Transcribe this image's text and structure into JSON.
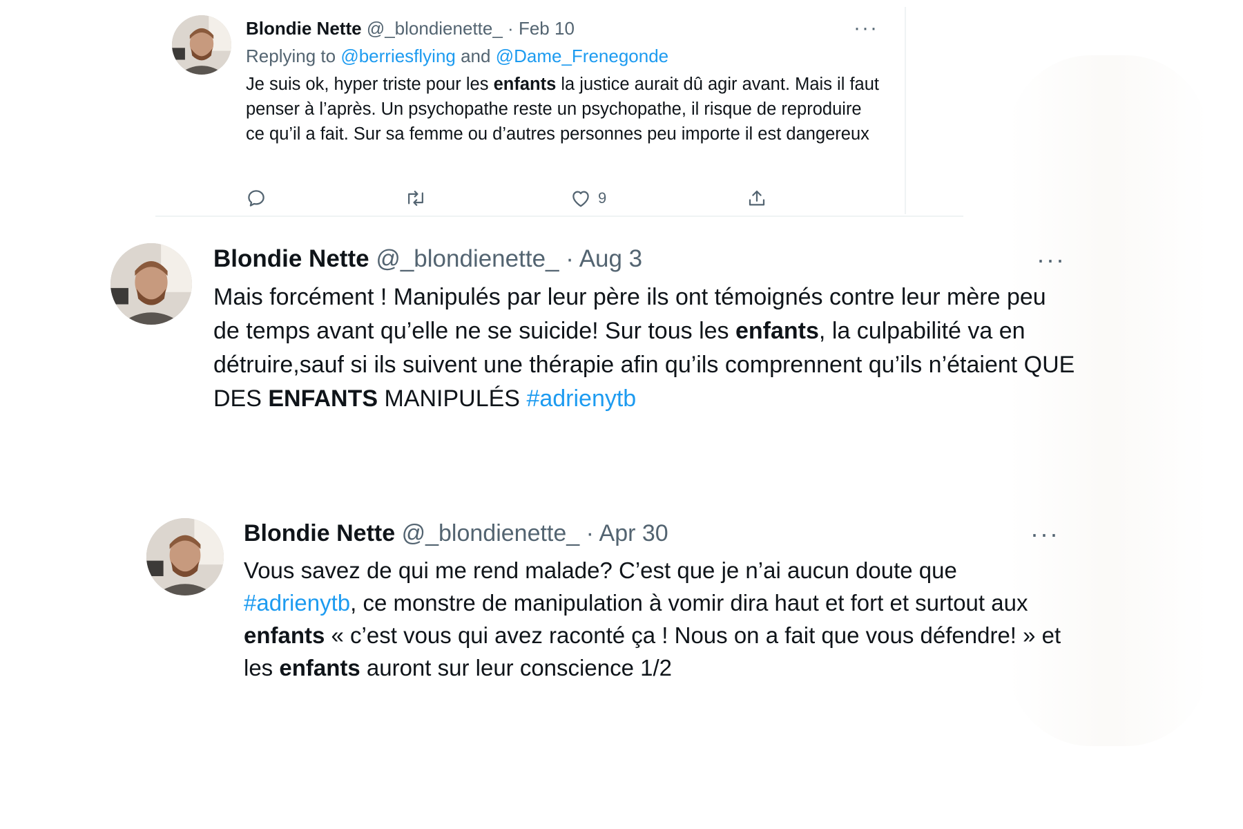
{
  "tweets": [
    {
      "author": {
        "name": "Blondie Nette",
        "handle": "@_blondienette_",
        "separator": "·",
        "date": "Feb 10",
        "avatar": "profile-photo"
      },
      "more_label": "···",
      "reply_prefix": "Replying to ",
      "reply_mention_1": "@berriesflying",
      "reply_and": " and ",
      "reply_mention_2": "@Dame_Frenegonde",
      "body": [
        {
          "text": "Je suis ok, hyper triste pour les "
        },
        {
          "text": "enfants",
          "bold": true
        },
        {
          "text": " la justice aurait dû agir avant. Mais il faut penser à l’après. Un psychopathe reste un psychopathe, il risque de reproduire ce qu’il a fait. Sur sa femme ou d’autres personnes peu importe il est dangereux"
        }
      ],
      "actions": {
        "reply_icon": "reply-icon",
        "retweet_icon": "retweet-icon",
        "like_icon": "heart-icon",
        "like_count": "9",
        "share_icon": "share-icon"
      }
    },
    {
      "author": {
        "name": "Blondie Nette",
        "handle": "@_blondienette_",
        "separator": "·",
        "date": "Aug 3",
        "avatar": "profile-photo"
      },
      "more_label": "···",
      "body": [
        {
          "text": "Mais forcément ! Manipulés par leur père ils ont témoignés contre leur mère peu de temps avant qu’elle ne se suicide! Sur tous les "
        },
        {
          "text": "enfants",
          "bold": true
        },
        {
          "text": ", la culpabilité va en détruire,sauf si ils suivent une thérapie afin qu’ils comprennent qu’ils n’étaient QUE DES "
        },
        {
          "text": "ENFANTS",
          "bold": true
        },
        {
          "text": " MANIPULÉS "
        },
        {
          "text": "#adrienytb",
          "hashtag": true
        }
      ]
    },
    {
      "author": {
        "name": "Blondie Nette",
        "handle": "@_blondienette_",
        "separator": "·",
        "date": "Apr 30",
        "avatar": "profile-photo"
      },
      "more_label": "···",
      "body": [
        {
          "text": "Vous savez de qui me rend malade? C’est que je n’ai aucun doute que "
        },
        {
          "text": "#adrienytb",
          "hashtag": true
        },
        {
          "text": ", ce monstre de manipulation à vomir dira haut et fort et surtout aux "
        },
        {
          "text": "enfants",
          "bold": true
        },
        {
          "text": " « c’est vous qui avez raconté ça ! Nous on a fait que vous défendre! » et les "
        },
        {
          "text": "enfants",
          "bold": true
        },
        {
          "text": " auront sur leur conscience 1/2"
        }
      ]
    }
  ],
  "colors": {
    "text": "#0f1419",
    "secondary": "#536471",
    "link": "#1d9bf0",
    "divider": "#eff3f4"
  }
}
